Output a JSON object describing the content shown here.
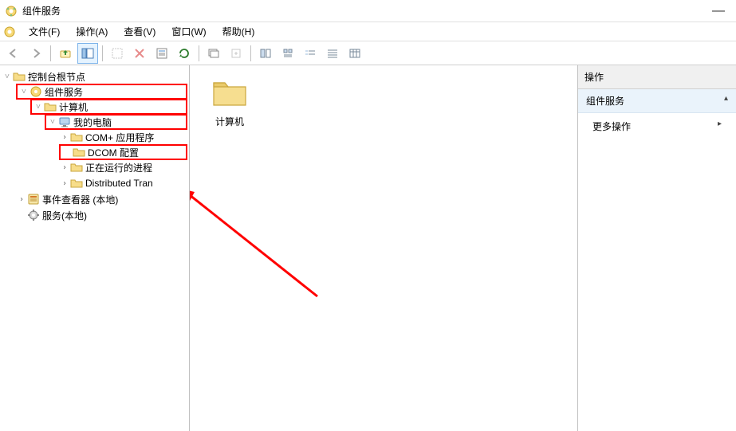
{
  "window": {
    "title": "组件服务",
    "minimize_glyph": "—"
  },
  "menu": {
    "file": "文件(F)",
    "action": "操作(A)",
    "view": "查看(V)",
    "window": "窗口(W)",
    "help": "帮助(H)"
  },
  "tree": {
    "root": "控制台根节点",
    "component_services": "组件服务",
    "computers": "计算机",
    "my_computer": "我的电脑",
    "com_plus_apps": "COM+ 应用程序",
    "dcom_config": "DCOM 配置",
    "running_processes": "正在运行的进程",
    "distributed_tran": "Distributed Tran",
    "event_viewer": "事件查看器 (本地)",
    "services": "服务(本地)"
  },
  "content": {
    "item_label": "计算机"
  },
  "actions": {
    "header": "操作",
    "sub": "组件服务",
    "more": "更多操作",
    "caret": "▸"
  }
}
